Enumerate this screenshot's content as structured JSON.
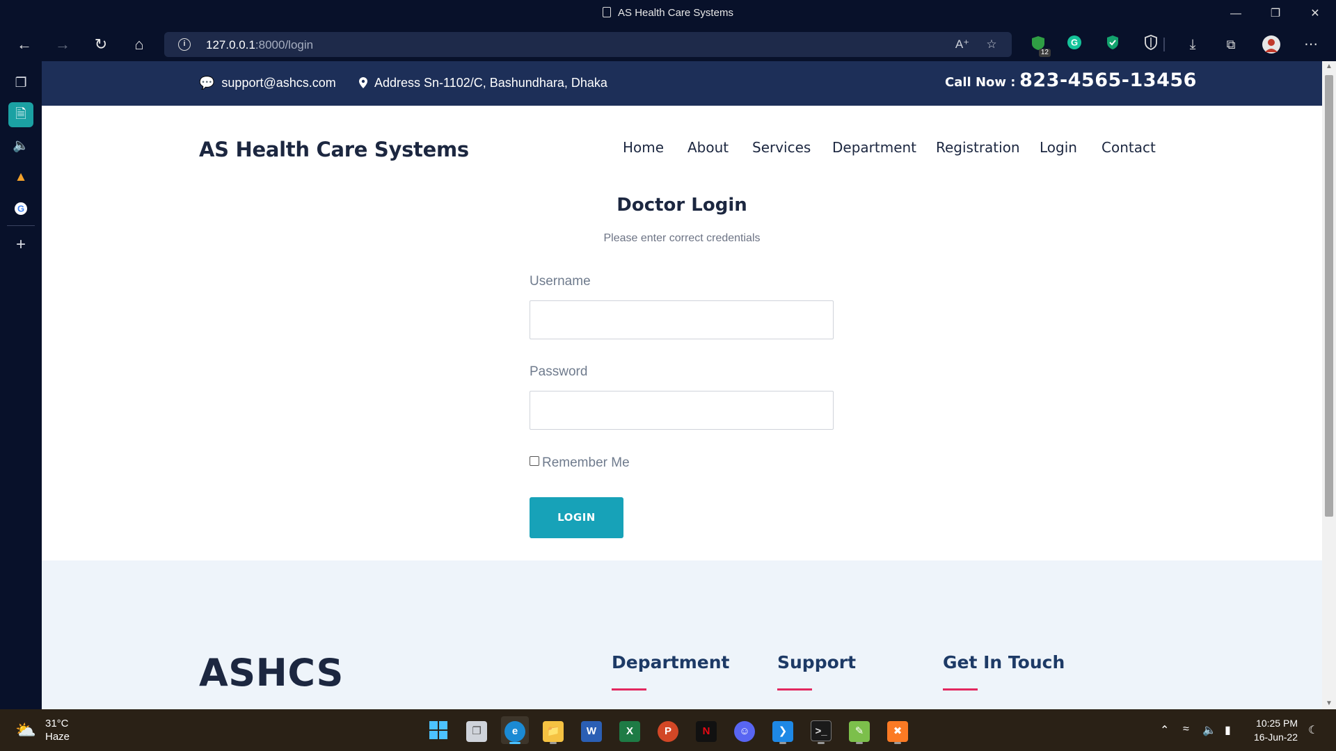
{
  "window": {
    "title": "AS Health Care Systems"
  },
  "addressbar": {
    "url_host": "127.0.0.1",
    "url_rest": ":8000/login"
  },
  "extensions": {
    "badge_count": "12"
  },
  "topbar": {
    "email": "support@ashcs.com",
    "address": "Address Sn-1102/C, Bashundhara, Dhaka",
    "call_label": "Call Now :",
    "phone": "823-4565-13456"
  },
  "brand": "AS Health Care Systems",
  "nav": [
    "Home",
    "About",
    "Services",
    "Department",
    "Registration",
    "Login",
    "Contact"
  ],
  "login": {
    "title": "Doctor Login",
    "subtitle": "Please enter correct credentials",
    "username_label": "Username",
    "username_value": "",
    "password_label": "Password",
    "password_value": "",
    "remember_label": "Remember Me",
    "remember_checked": false,
    "button": "LOGIN"
  },
  "footer": {
    "logo": "ASHCS",
    "columns": [
      "Department",
      "Support",
      "Get In Touch"
    ]
  },
  "taskbar": {
    "weather_temp": "31°C",
    "weather_condition": "Haze",
    "time": "10:25 PM",
    "date": "16-Jun-22"
  },
  "colors": {
    "topbar_bg": "#1d2f58",
    "accent_button": "#17a2b8",
    "footer_bar": "#e2275f",
    "text_dark": "#1c2740"
  }
}
